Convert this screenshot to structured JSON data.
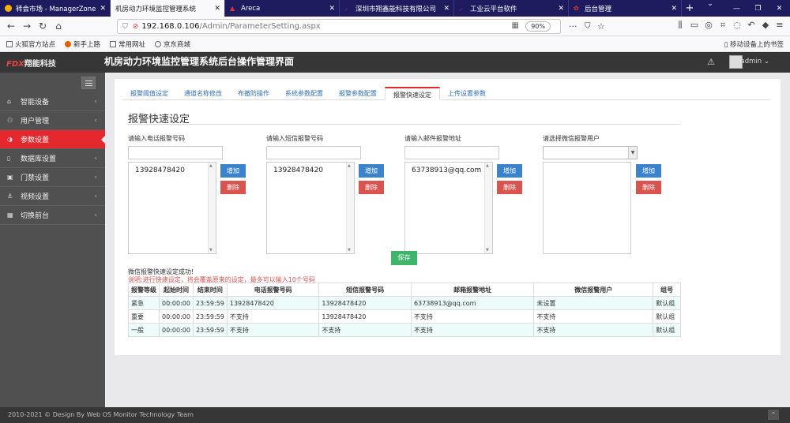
{
  "browser": {
    "tabs": [
      {
        "title": "转会市场 - ManagerZone",
        "color": "#ffb000"
      },
      {
        "title": "机房动力环境监控管理系统",
        "color": "#e64444",
        "active": true
      },
      {
        "title": "Areca",
        "color": "#d9373a"
      },
      {
        "title": "深圳市翔鑫能科技有限公司",
        "color": "#e64444"
      },
      {
        "title": "工业云平台软件",
        "color": "#e64444"
      },
      {
        "title": "后台管理",
        "color": "#d9373a"
      }
    ],
    "url_host": "192.168.0.106",
    "url_path": "/Admin/ParameterSetting.aspx",
    "zoom": "90%",
    "bookmarks": [
      "火狐官方站点",
      "新手上路",
      "常用网址",
      "京东商城"
    ],
    "bookmarks_right": "移动设备上的书签"
  },
  "app": {
    "logo_mark": "FDX",
    "logo_text": "翔能科技",
    "title": "机房动力环境监控管理系统后台操作管理界面",
    "user": "admin"
  },
  "sidebar": {
    "items": [
      {
        "label": "智能设备",
        "icon": "home-icon",
        "glyph": "⌂"
      },
      {
        "label": "用户管理",
        "icon": "users-icon",
        "glyph": "⚇"
      },
      {
        "label": "参数设置",
        "icon": "half-circle-icon",
        "glyph": "◑",
        "active": true
      },
      {
        "label": "数据库设置",
        "icon": "book-icon",
        "glyph": "▯"
      },
      {
        "label": "门禁设置",
        "icon": "lock-icon",
        "glyph": "▣"
      },
      {
        "label": "视频设置",
        "icon": "anchor-icon",
        "glyph": "⚓"
      },
      {
        "label": "切换前台",
        "icon": "grid-icon",
        "glyph": "▦"
      }
    ]
  },
  "page_tabs": [
    "报警阈值设定",
    "通道名称修改",
    "布撤防操作",
    "系统参数配置",
    "报警参数配置",
    "报警快速设定",
    "上传设置参数"
  ],
  "active_tab": "报警快速设定",
  "section_title": "报警快速设定",
  "columns": [
    {
      "label": "请输入电话报警号码",
      "value": "13928478420"
    },
    {
      "label": "请输入短信报警号码",
      "value": "13928478420"
    },
    {
      "label": "请输入邮件报警地址",
      "value": "63738913@qq.com"
    },
    {
      "label": "请选择微信报警用户",
      "value": ""
    }
  ],
  "buttons": {
    "add": "增加",
    "delete": "删除",
    "save": "保存"
  },
  "messages": {
    "success": "微信报警快速设定成功!",
    "note": "说明:进行快速设定，将会覆盖原来的设定，最多可以输入10个号码"
  },
  "table": {
    "headers": [
      "报警等级",
      "起始时间",
      "结束时间",
      "电话报警号码",
      "短信报警号码",
      "邮箱报警地址",
      "微信报警用户",
      "组号"
    ],
    "rows": [
      [
        "紧急",
        "00:00:00",
        "23:59:59",
        "13928478420",
        "13928478420",
        "63738913@qq.com",
        "未设置",
        "默认组"
      ],
      [
        "重要",
        "00:00:00",
        "23:59:59",
        "不支持",
        "13928478420",
        "不支持",
        "不支持",
        "默认组"
      ],
      [
        "一般",
        "00:00:00",
        "23:59:59",
        "不支持",
        "不支持",
        "不支持",
        "不支持",
        "默认组"
      ]
    ]
  },
  "footer": "2010-2021 © Design By Web OS Monitor Technology Team"
}
